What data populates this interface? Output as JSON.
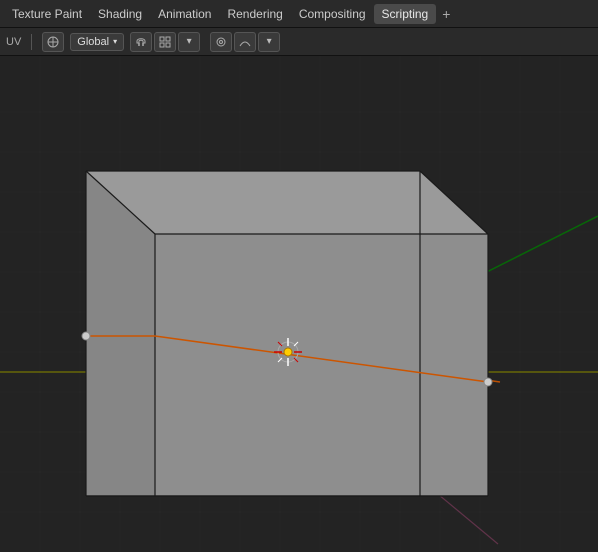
{
  "topMenu": {
    "items": [
      {
        "label": "Texture Paint",
        "active": false
      },
      {
        "label": "Shading",
        "active": false
      },
      {
        "label": "Animation",
        "active": false
      },
      {
        "label": "Rendering",
        "active": false
      },
      {
        "label": "Compositing",
        "active": false
      },
      {
        "label": "Scripting",
        "active": true
      }
    ],
    "plus_label": "+"
  },
  "toolbar": {
    "uv_label": "UV",
    "transform_label": "Global",
    "icons": [
      "↻",
      "⬜",
      "∧"
    ]
  },
  "viewport": {
    "bg_color": "#232323",
    "grid_color": "#2e2e2e",
    "cube": {
      "color": "#8a8a8a",
      "edge_color": "#1a1a1a"
    },
    "axis": {
      "x_color": "#992222",
      "y_color": "#229922"
    }
  }
}
